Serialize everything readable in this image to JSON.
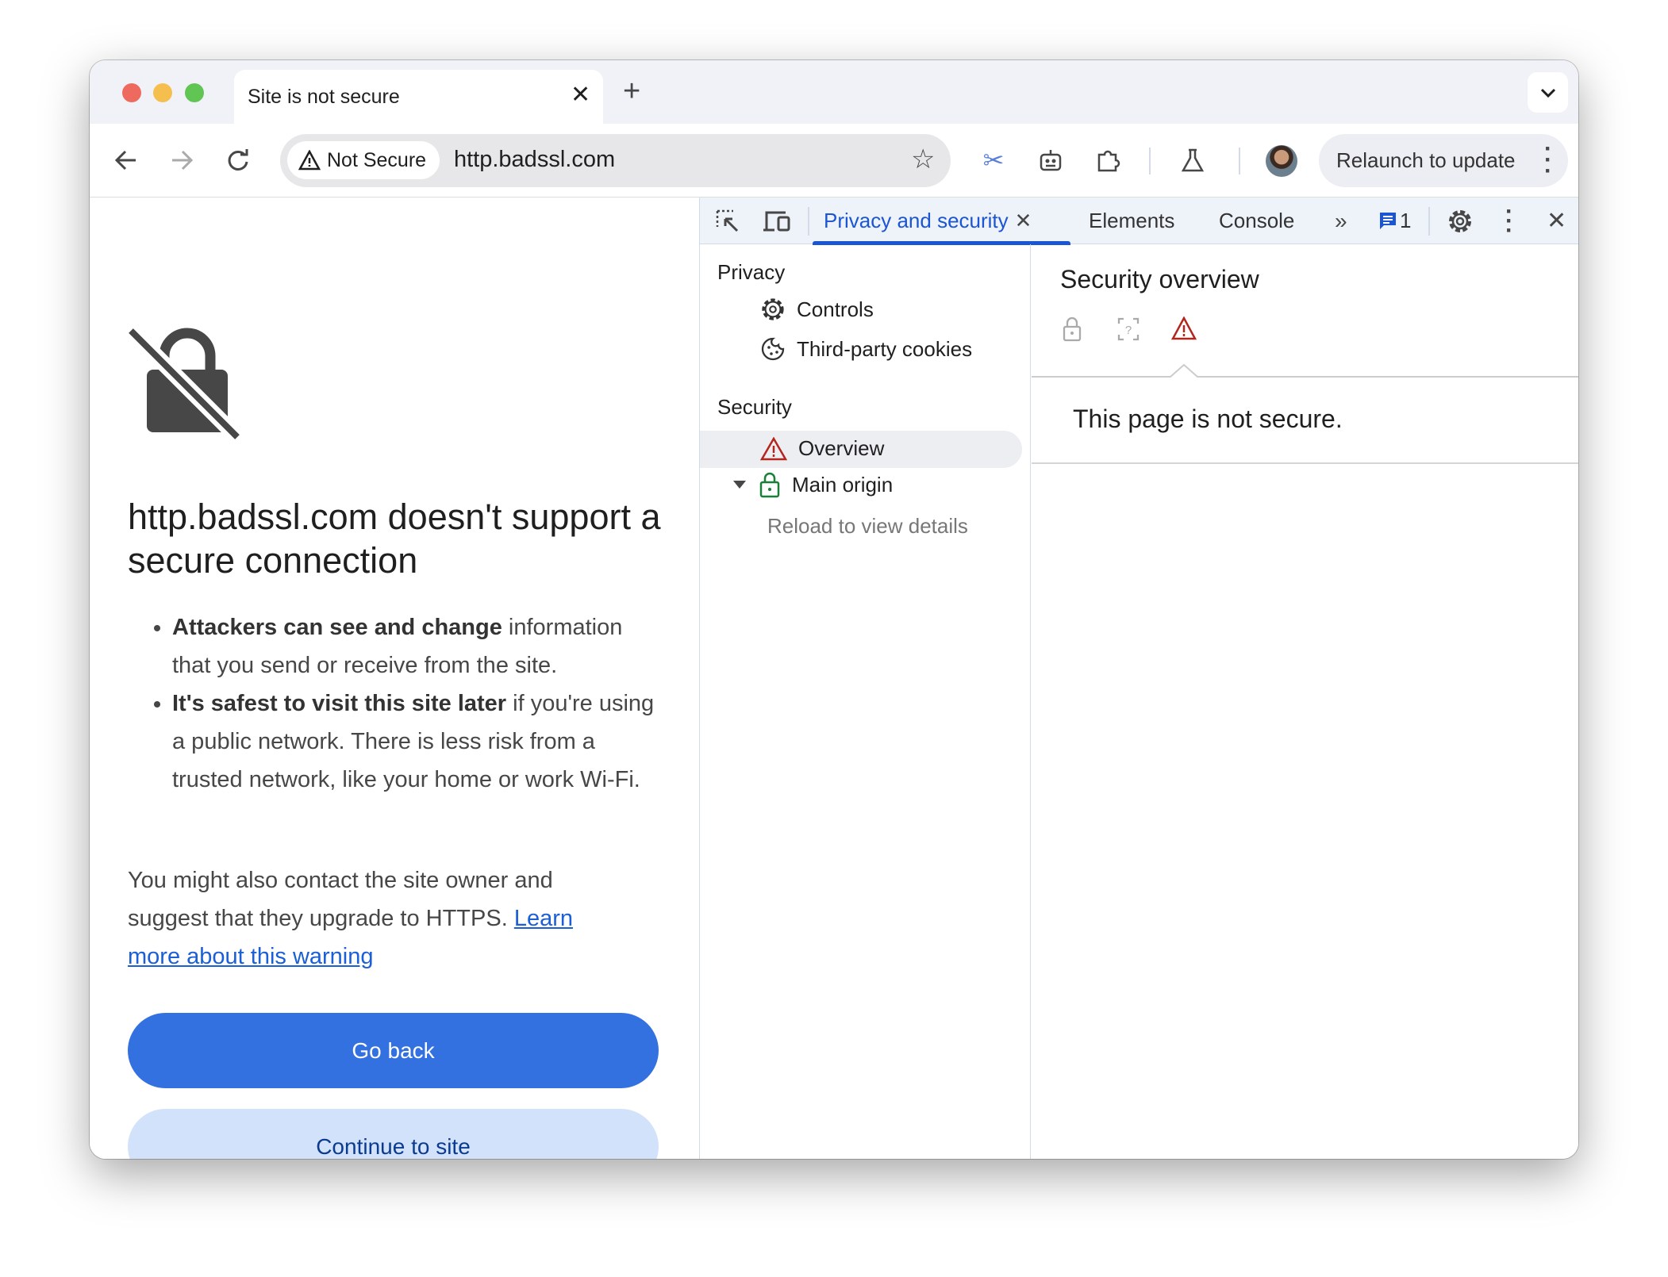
{
  "browser": {
    "tab_title": "Site is not secure",
    "security_chip": "Not Secure",
    "url": "http.badssl.com",
    "relaunch_label": "Relaunch to update"
  },
  "page": {
    "heading": "http.badssl.com doesn't support a secure connection",
    "bullets": [
      {
        "bold": "Attackers can see and change",
        "rest": " information that you send or receive from the site."
      },
      {
        "bold": "It's safest to visit this site later",
        "rest": " if you're using a public network. There is less risk from a trusted network, like your home or work Wi-Fi."
      }
    ],
    "paragraph": "You might also contact the site owner and suggest that they upgrade to HTTPS. ",
    "link": "Learn more about this warning",
    "go_back": "Go back",
    "continue": "Continue to site",
    "colors": {
      "primary": "#3370e0",
      "secondary": "#d3e2fb",
      "link": "#1a5fd6"
    }
  },
  "devtools": {
    "tabs": [
      {
        "label": "Privacy and security",
        "active": true
      },
      {
        "label": "Elements"
      },
      {
        "label": "Console"
      }
    ],
    "message_count": "1",
    "sidebar": {
      "privacy_heading": "Privacy",
      "privacy_items": [
        {
          "label": "Controls",
          "icon": "gear-icon"
        },
        {
          "label": "Third-party cookies",
          "icon": "cookie-icon"
        }
      ],
      "security_heading": "Security",
      "overview": "Overview",
      "main_origin": "Main origin",
      "reload_hint": "Reload to view details"
    },
    "main": {
      "title": "Security overview",
      "summary": "This page is not secure."
    }
  }
}
